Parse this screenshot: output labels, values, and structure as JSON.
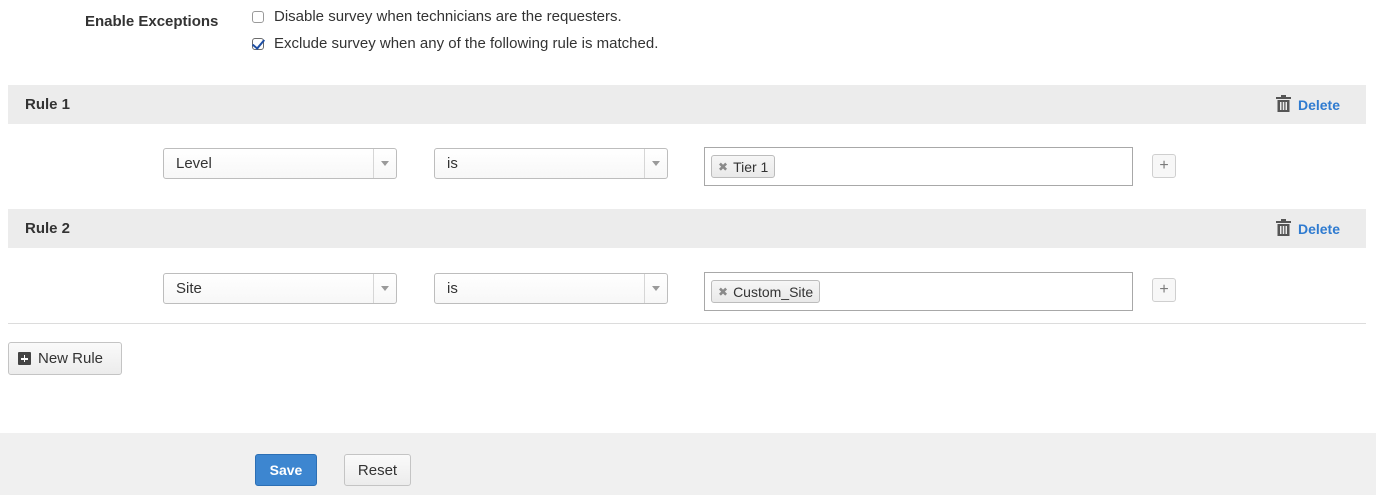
{
  "exceptions": {
    "label": "Enable Exceptions",
    "options": [
      {
        "label": "Disable survey when technicians are the requesters.",
        "checked": false
      },
      {
        "label": "Exclude survey when any of the following rule is matched.",
        "checked": true
      }
    ]
  },
  "rules": [
    {
      "title": "Rule 1",
      "delete_label": "Delete",
      "field": "Level",
      "operator": "is",
      "values": [
        "Tier 1"
      ],
      "add_label": "+"
    },
    {
      "title": "Rule 2",
      "delete_label": "Delete",
      "field": "Site",
      "operator": "is",
      "values": [
        "Custom_Site"
      ],
      "add_label": "+"
    }
  ],
  "new_rule_label": "New Rule",
  "footer": {
    "save_label": "Save",
    "reset_label": "Reset"
  },
  "colors": {
    "accent": "#3d86d0",
    "link": "#2f7bd0",
    "header_bg": "#ececec"
  }
}
